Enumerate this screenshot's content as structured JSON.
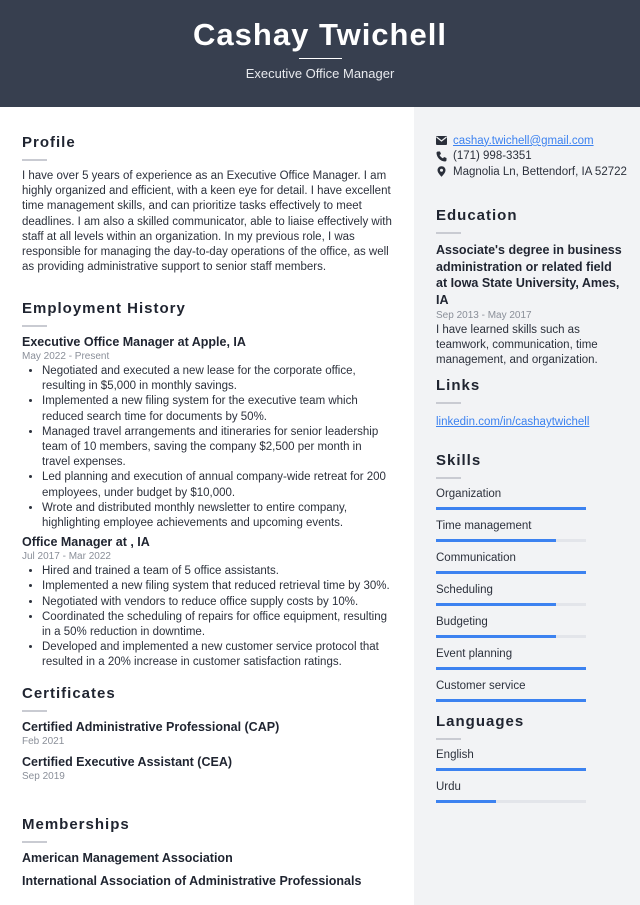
{
  "header": {
    "name": "Cashay Twichell",
    "title": "Executive Office Manager"
  },
  "profile": {
    "heading": "Profile",
    "text": "I have over 5 years of experience as an Executive Office Manager. I am highly organized and efficient, with a keen eye for detail. I have excellent time management skills, and can prioritize tasks effectively to meet deadlines. I am also a skilled communicator, able to liaise effectively with staff at all levels within an organization. In my previous role, I was responsible for managing the day-to-day operations of the office, as well as providing administrative support to senior staff members."
  },
  "employment": {
    "heading": "Employment History",
    "jobs": [
      {
        "title": "Executive Office Manager at Apple, IA",
        "dates": "May 2022 - Present",
        "bullets": [
          "Negotiated and executed a new lease for the corporate office, resulting in $5,000 in monthly savings.",
          "Implemented a new filing system for the executive team which reduced search time for documents by 50%.",
          "Managed travel arrangements and itineraries for senior leadership team of 10 members, saving the company $2,500 per month in travel expenses.",
          "Led planning and execution of annual company-wide retreat for 200 employees, under budget by $10,000.",
          "Wrote and distributed monthly newsletter to entire company, highlighting employee achievements and upcoming events."
        ]
      },
      {
        "title": "Office Manager at , IA",
        "dates": "Jul 2017 - Mar 2022",
        "bullets": [
          "Hired and trained a team of 5 office assistants.",
          "Implemented a new filing system that reduced retrieval time by 30%.",
          "Negotiated with vendors to reduce office supply costs by 10%.",
          "Coordinated the scheduling of repairs for office equipment, resulting in a 50% reduction in downtime.",
          "Developed and implemented a new customer service protocol that resulted in a 20% increase in customer satisfaction ratings."
        ]
      }
    ]
  },
  "certificates": {
    "heading": "Certificates",
    "items": [
      {
        "name": "Certified Administrative Professional (CAP)",
        "date": "Feb 2021"
      },
      {
        "name": "Certified Executive Assistant (CEA)",
        "date": "Sep 2019"
      }
    ]
  },
  "memberships": {
    "heading": "Memberships",
    "items": [
      "American Management Association",
      "International Association of Administrative Professionals"
    ]
  },
  "contact": {
    "email": "cashay.twichell@gmail.com",
    "phone": "(171) 998-3351",
    "address": "Magnolia Ln, Bettendorf, IA 52722",
    "icons": {
      "email": "envelope-icon",
      "phone": "phone-icon",
      "address": "map-pin-icon"
    }
  },
  "education": {
    "heading": "Education",
    "degree": "Associate's degree in business administration or related field at Iowa State University, Ames, IA",
    "dates": "Sep 2013 - May 2017",
    "description": "I have learned skills such as teamwork, communication, time management, and organization."
  },
  "links": {
    "heading": "Links",
    "items": [
      "linkedin.com/in/cashaytwichell"
    ]
  },
  "skills": {
    "heading": "Skills",
    "items": [
      {
        "name": "Organization",
        "level": 1.0
      },
      {
        "name": "Time management",
        "level": 0.8
      },
      {
        "name": "Communication",
        "level": 1.0
      },
      {
        "name": "Scheduling",
        "level": 0.8
      },
      {
        "name": "Budgeting",
        "level": 0.8
      },
      {
        "name": "Event planning",
        "level": 1.0
      },
      {
        "name": "Customer service",
        "level": 1.0
      }
    ]
  },
  "languages": {
    "heading": "Languages",
    "items": [
      {
        "name": "English",
        "level": 1.0
      },
      {
        "name": "Urdu",
        "level": 0.4
      }
    ]
  },
  "colors": {
    "header_bg": "#373f4f",
    "accent": "#3c82f0",
    "sidebar_bg": "#f2f3f5"
  }
}
